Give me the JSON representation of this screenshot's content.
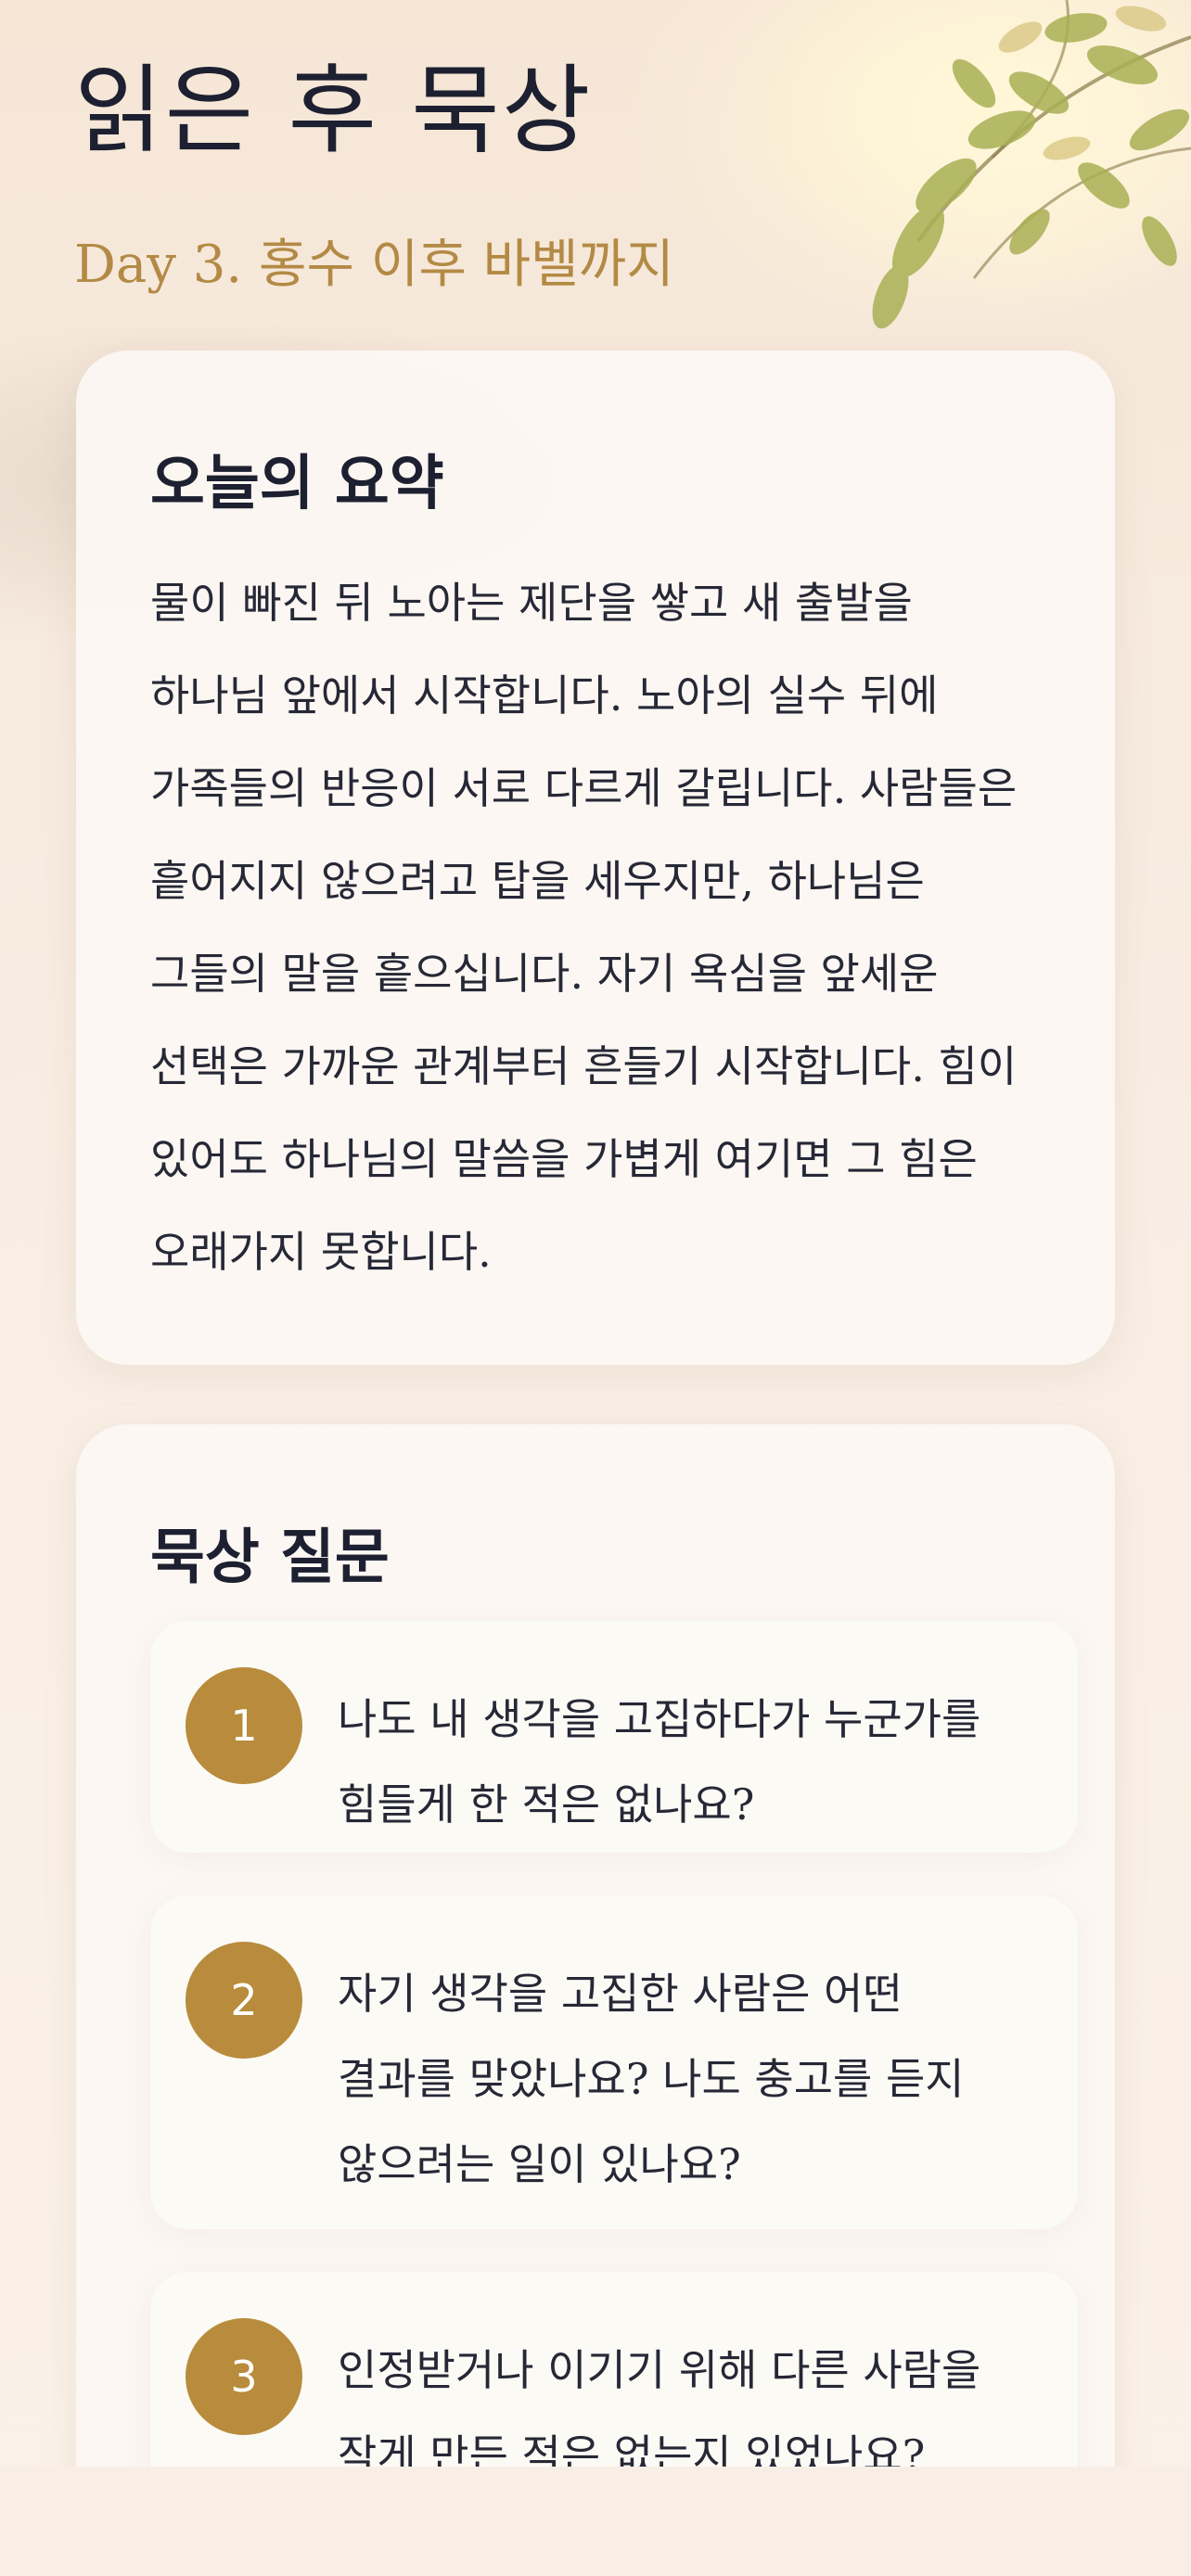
{
  "header": {
    "title": "읽은 후 묵상",
    "subtitle": "Day 3. 홍수 이후 바벨까지"
  },
  "summary": {
    "heading": "오늘의 요약",
    "text": "물이 빠진 뒤 노아는 제단을 쌓고 새 출발을 하나님 앞에서 시작합니다. 노아의 실수 뒤에 가족들의 반응이 서로 다르게 갈립니다. 사람들은 흩어지지 않으려고 탑을 세우지만, 하나님은 그들의 말을 흩으십니다. 자기 욕심을 앞세운 선택은 가까운 관계부터 흔들기 시작합니다. 힘이 있어도 하나님의 말씀을 가볍게 여기면 그 힘은 오래가지 못합니다."
  },
  "questions": {
    "heading": "묵상 질문",
    "items": [
      {
        "number": "1",
        "text": "나도 내 생각을 고집하다가 누군가를 힘들게 한 적은 없나요?"
      },
      {
        "number": "2",
        "text": "자기 생각을 고집한 사람은 어떤 결과를 맞았나요? 나도 충고를 듣지 않으려는 일이 있나요?"
      },
      {
        "number": "3",
        "text": "인정받거나 이기기 위해 다른 사람을 작게 만든 적은 없는지 있었나요?"
      }
    ]
  },
  "colors": {
    "accent": "#b88c3c",
    "subtitle": "#b38a45",
    "text": "#1d2030",
    "background": "#f8ede2"
  },
  "decoration": {
    "icon": "leaves-branch-icon"
  }
}
